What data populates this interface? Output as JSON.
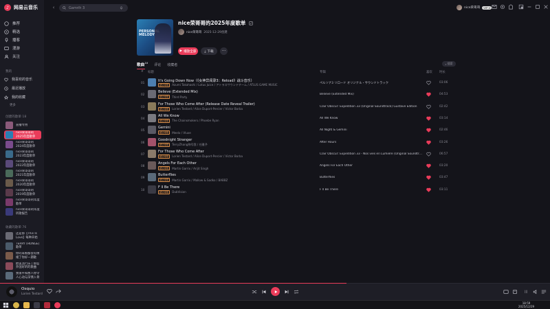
{
  "app": {
    "name": "网易云音乐"
  },
  "sidebar": {
    "nav": [
      {
        "label": "推荐",
        "icon": "home-icon"
      },
      {
        "label": "精选",
        "icon": "compass-icon"
      },
      {
        "label": "播客",
        "icon": "podcast-icon"
      },
      {
        "label": "漫游",
        "icon": "roam-icon"
      },
      {
        "label": "关注",
        "icon": "follow-icon"
      }
    ],
    "my_header": "我的",
    "my_items": [
      {
        "label": "我喜欢的音乐",
        "icon": "heart-icon"
      },
      {
        "label": "最近播放",
        "icon": "clock-icon"
      },
      {
        "label": "我的收藏",
        "icon": "star-icon"
      }
    ],
    "more_label": "更多",
    "created_header": "创建的歌单 18",
    "created": [
      {
        "label": "直播专用",
        "color": "#8a5a7a"
      },
      {
        "label": "nice荣哥哥的2025年度歌单",
        "color": "#2a7fb4"
      },
      {
        "label": "nice荣哥哥的2024年度歌单",
        "color": "#7a4b8c"
      },
      {
        "label": "nice荣哥哥的2023年度歌单",
        "color": "#3a6a8a"
      },
      {
        "label": "nice荣哥哥的2022年度歌单",
        "color": "#5a4a7a"
      },
      {
        "label": "nice荣哥哥的2021年度歌单",
        "color": "#4a6a5a"
      },
      {
        "label": "nice荣哥哥的2020年度歌单",
        "color": "#6a5a4a"
      },
      {
        "label": "nice荣哥哥的2019年度歌单",
        "color": "#5a3a4a"
      },
      {
        "label": "nice荣哥哥的年度歌单",
        "color": "#7a3a6a"
      },
      {
        "label": "nice荣哥哥的年度听歌报告",
        "color": "#3a3a7a"
      }
    ],
    "fav_header": "收藏的歌单 76",
    "favorites": [
      {
        "label": "还是那【This Is Love】每种开始",
        "color": "#6a6a74"
      },
      {
        "label": "TERRY (HONGE) 歌单",
        "color": "#4a5a6a"
      },
      {
        "label": "你的耳根都会有情绪了你好一期歌",
        "color": "#7a5a4a"
      },
      {
        "label": "欧美流行乐 | 那些外国好听的歌曲",
        "color": "#8a4a5a"
      },
      {
        "label": "我很平和想人你令人心动与深情入骨",
        "color": "#5a6a7a"
      }
    ]
  },
  "topbar": {
    "search_placeholder": "Gamrih 3",
    "user_name": "nice荣哥哥",
    "vip_label": "VIP 4"
  },
  "playlist": {
    "cover_text": "PERSONAL MELODY",
    "title": "nice荣哥哥的2025年度歌单",
    "creator": "nice荣哥哥",
    "created_date": "2025-12-29创建",
    "play_all_label": "播放全部",
    "download_label": "下载",
    "more_label": "···"
  },
  "tabs": [
    {
      "label": "歌曲",
      "count": "10"
    },
    {
      "label": "评论"
    },
    {
      "label": "收藏者"
    }
  ],
  "list_search_label": "搜索",
  "columns": {
    "index": "#",
    "title": "标题",
    "album": "专辑",
    "like": "喜欢",
    "duration": "时长"
  },
  "songs": [
    {
      "no": "01",
      "title": "It's Going Down Now（《女神异闻录3：Reload》战斗音乐）",
      "artist": "Azumi Takahashi / Lotus Juice / アトラスサウンドチーム / ATLUS GAME MUSIC",
      "album": "ペルソナ3 リロード オリジナル・サウンドトラック",
      "liked": false,
      "duration": "03:06",
      "color": "#4d7fb0"
    },
    {
      "no": "02",
      "title": "Believe (Extended Mix)",
      "artist": "Third Party",
      "album": "Believe (Extended Mix)",
      "liked": true,
      "duration": "04:53",
      "color": "#6a6a74"
    },
    {
      "no": "03",
      "title": "For Those Who Come After (Release Date Reveal Trailer)",
      "artist": "Lorien Testard / Alice Duport-Percier / Victor Borba",
      "album": "Clair Obscur: Expedition 33 (Original Soundtrack) Gustave Edition",
      "liked": false,
      "duration": "02:42",
      "color": "#8a7a5a"
    },
    {
      "no": "04",
      "title": "All We Know",
      "artist": "The Chainsmokers / Phoebe Ryan",
      "album": "All We Know",
      "liked": true,
      "duration": "03:14",
      "color": "#7a7a80"
    },
    {
      "no": "05",
      "title": "Gemini",
      "artist": "Meelo / Vluxe",
      "album": "All Night & Gemini",
      "liked": true,
      "duration": "02:46",
      "color": "#5a5a64"
    },
    {
      "no": "06",
      "title": "Goodnight Stranger",
      "artist": "TerryZhang称号我 / 任雅予",
      "album": "After Hours",
      "liked": true,
      "duration": "03:26",
      "color": "#a4526a"
    },
    {
      "no": "07",
      "title": "For Those Who Come After",
      "artist": "Lorien Testard / Alice Duport-Percier / Victor Borba",
      "album": "Clair Obscur: Expedition 33 - Nos vies en Lumière (Original Soundtrack) (Bu...",
      "liked": false,
      "duration": "06:57",
      "color": "#8a7a6a"
    },
    {
      "no": "08",
      "title": "Angels For Each Other",
      "artist": "Martin Garrix / Arijit Singh",
      "album": "Angels For Each Other",
      "liked": true,
      "duration": "03:20",
      "color": "#6a5a5a"
    },
    {
      "no": "09",
      "title": "Butterflies",
      "artist": "Martin Garrix / Mallow & Sadko / BABBZ",
      "album": "Butterflies",
      "liked": true,
      "duration": "03:47",
      "color": "#5a6a7a"
    },
    {
      "no": "10",
      "title": "F  ll Be There",
      "artist": "DubVision",
      "album": "F  ll Be There",
      "liked": true,
      "duration": "03:11",
      "color": "#3a3a44"
    }
  ],
  "tag_label": "超清母带",
  "player": {
    "title": "Osquio",
    "artist": "Lorien Testard",
    "progress": 0.63,
    "volume_label": "|||"
  },
  "taskbar": {
    "time": "18:59",
    "date": "2025/12/29"
  },
  "colors": {
    "accent": "#ea3c5a",
    "background": "#14141a",
    "sidebar": "#1b1b23"
  }
}
